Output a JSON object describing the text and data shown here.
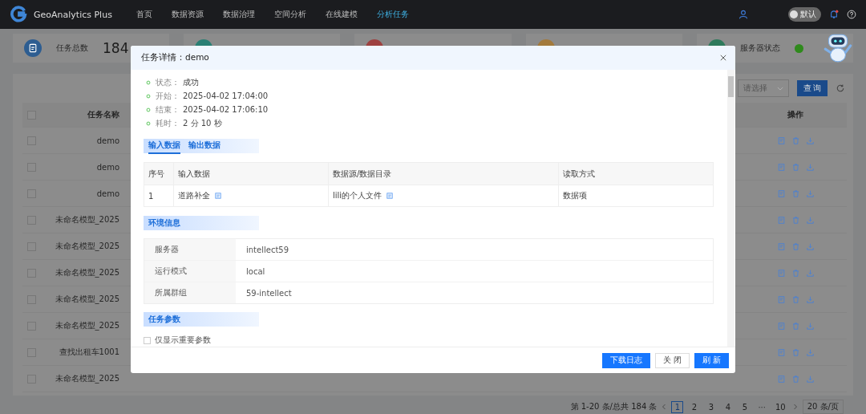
{
  "app": {
    "name": "GeoAnalytics Plus"
  },
  "nav": [
    {
      "label": "首页",
      "selected": false
    },
    {
      "label": "数据资源",
      "selected": false
    },
    {
      "label": "数据治理",
      "selected": false
    },
    {
      "label": "空间分析",
      "selected": false
    },
    {
      "label": "在线建模",
      "selected": false
    },
    {
      "label": "分析任务",
      "selected": true
    }
  ],
  "header_right": {
    "theme_toggle": {
      "label": "默认",
      "on": false
    },
    "notifications": {
      "unread": true
    }
  },
  "stats": [
    {
      "label": "任务总数",
      "value": "184",
      "color": "#2d5d91"
    },
    {
      "color": "#2a7f74"
    },
    {
      "color": "#9e4140"
    },
    {
      "color": "#a37a3c"
    },
    {
      "label": "服务器状态",
      "color": "#2f7a5c",
      "status_dot": {
        "color": "#2f8a1c"
      }
    }
  ],
  "filters": {
    "select_placeholder": "请选择",
    "query_button": "查 询"
  },
  "tasks": {
    "columns": [
      "任务名称",
      "操作"
    ],
    "all_checked": false,
    "rows": [
      {
        "name": "demo",
        "checked": false
      },
      {
        "name": "demo",
        "checked": false
      },
      {
        "name": "demo",
        "checked": false
      },
      {
        "name": "未命名模型_2025",
        "checked": false
      },
      {
        "name": "未命名模型_2025",
        "checked": false
      },
      {
        "name": "未命名模型_2025",
        "checked": false
      },
      {
        "name": "未命名模型_2025",
        "checked": false
      },
      {
        "name": "未命名模型_2025",
        "checked": false
      },
      {
        "name": "查找出租车1001",
        "checked": false
      },
      {
        "name": "未命名模型_2025",
        "checked": false
      }
    ]
  },
  "pagination": {
    "summary": "第 1-20 条/总共 184 条",
    "pages": [
      {
        "label": "1",
        "kind": "page",
        "selected": true
      },
      {
        "label": "2",
        "kind": "page",
        "selected": false
      },
      {
        "label": "3",
        "kind": "page",
        "selected": false
      },
      {
        "label": "4",
        "kind": "page",
        "selected": false
      },
      {
        "label": "5",
        "kind": "page",
        "selected": false
      },
      {
        "label": "···",
        "kind": "ellipsis"
      },
      {
        "label": "10",
        "kind": "page",
        "selected": false
      }
    ],
    "page_size": "20 条/页"
  },
  "modal": {
    "title": "任务详情：demo",
    "status": [
      {
        "label": "状态：",
        "value": "成功"
      },
      {
        "label": "开始：",
        "value": "2025-04-02 17:04:00"
      },
      {
        "label": "结束：",
        "value": "2025-04-02 17:06:10"
      },
      {
        "label": "耗时：",
        "value": "2 分 10 秒"
      }
    ],
    "tabs": [
      {
        "label": "输入数据",
        "selected": true
      },
      {
        "label": "输出数据",
        "selected": false
      }
    ],
    "input_table": {
      "columns": [
        "序号",
        "输入数据",
        "数据源/数据目录",
        "读取方式"
      ],
      "rows": [
        {
          "index": "1",
          "input": "道路补全",
          "source": "lili的个人文件",
          "read_mode": "数据项"
        }
      ]
    },
    "env_title": "环境信息",
    "env": [
      {
        "label": "服务器",
        "value": "intellect59"
      },
      {
        "label": "运行模式",
        "value": "local"
      },
      {
        "label": "所属群组",
        "value": "59-intellect"
      }
    ],
    "params_title": "任务参数",
    "params_filter": {
      "label": "仅显示重要参数",
      "checked": false
    },
    "buttons": [
      {
        "label": "下载日志",
        "kind": "primary"
      },
      {
        "label": "关 闭",
        "kind": "default"
      },
      {
        "label": "刷 新",
        "kind": "primary"
      }
    ]
  }
}
